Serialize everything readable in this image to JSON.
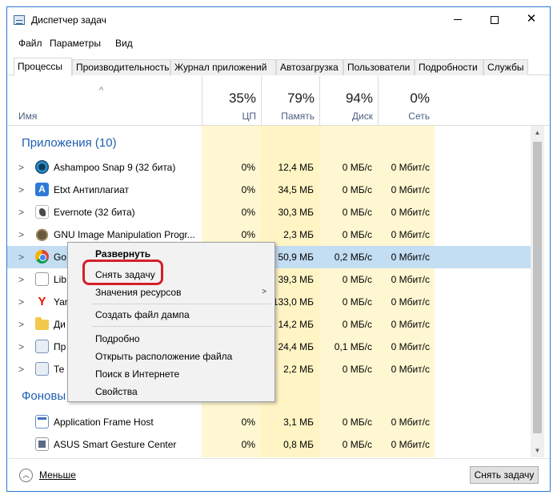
{
  "window": {
    "title": "Диспетчер задач"
  },
  "menu": [
    "Файл",
    "Параметры",
    "Вид"
  ],
  "tabs": [
    "Процессы",
    "Производительность",
    "Журнал приложений",
    "Автозагрузка",
    "Пользователи",
    "Подробности",
    "Службы"
  ],
  "columns": {
    "name": "Имя",
    "cpu": {
      "pct": "35%",
      "label": "ЦП"
    },
    "mem": {
      "pct": "79%",
      "label": "Память"
    },
    "disk": {
      "pct": "94%",
      "label": "Диск"
    },
    "net": {
      "pct": "0%",
      "label": "Сеть"
    }
  },
  "groups": {
    "apps": "Приложения (10)",
    "background": "Фоновы"
  },
  "rows": [
    {
      "name": "Ashampoo Snap 9 (32 бита)",
      "icon": "ashampoo-icon",
      "cpu": "0%",
      "mem": "12,4 МБ",
      "disk": "0 МБ/с",
      "net": "0 Мбит/с"
    },
    {
      "name": "Etxt Антиплагиат",
      "icon": "etxt-icon",
      "cpu": "0%",
      "mem": "34,5 МБ",
      "disk": "0 МБ/с",
      "net": "0 Мбит/с"
    },
    {
      "name": "Evernote (32 бита)",
      "icon": "evernote-icon",
      "cpu": "0%",
      "mem": "30,3 МБ",
      "disk": "0 МБ/с",
      "net": "0 Мбит/с"
    },
    {
      "name": "GNU Image Manipulation Progr...",
      "icon": "gimp-icon",
      "cpu": "0%",
      "mem": "2,3 МБ",
      "disk": "0 МБ/с",
      "net": "0 Мбит/с"
    },
    {
      "name": "Go",
      "icon": "chrome-icon",
      "cpu": "",
      "mem": "50,9 МБ",
      "disk": "0,2 МБ/с",
      "net": "0 Мбит/с"
    },
    {
      "name": "Lib",
      "icon": "libreoffice-icon",
      "cpu": "",
      "mem": "39,3 МБ",
      "disk": "0 МБ/с",
      "net": "0 Мбит/с"
    },
    {
      "name": "Yar",
      "icon": "yandex-icon",
      "cpu": "",
      "mem": "133,0 МБ",
      "disk": "0 МБ/с",
      "net": "0 Мбит/с"
    },
    {
      "name": "Ди",
      "icon": "folder-icon",
      "cpu": "",
      "mem": "14,2 МБ",
      "disk": "0 МБ/с",
      "net": "0 Мбит/с"
    },
    {
      "name": "Пр",
      "icon": "program-icon",
      "cpu": "",
      "mem": "24,4 МБ",
      "disk": "0,1 МБ/с",
      "net": "0 Мбит/с"
    },
    {
      "name": "Те",
      "icon": "text-editor-icon",
      "cpu": "",
      "mem": "2,2 МБ",
      "disk": "0 МБ/с",
      "net": "0 Мбит/с"
    }
  ],
  "bg_rows": [
    {
      "name": "Application Frame Host",
      "icon": "frame-host-icon",
      "cpu": "0%",
      "mem": "3,1 МБ",
      "disk": "0 МБ/с",
      "net": "0 Мбит/с"
    },
    {
      "name": "ASUS Smart Gesture Center",
      "icon": "asus-icon",
      "cpu": "0%",
      "mem": "0,8 МБ",
      "disk": "0 МБ/с",
      "net": "0 Мбит/с"
    }
  ],
  "context_menu": {
    "expand": "Развернуть",
    "end_task": "Снять задачу",
    "resource_values": "Значения ресурсов",
    "create_dump": "Создать файл дампа",
    "details": "Подробно",
    "open_location": "Открыть расположение файла",
    "search_online": "Поиск в Интернете",
    "properties": "Свойства"
  },
  "footer": {
    "less_label": "Меньше",
    "end_task_button": "Снять задачу"
  },
  "colors": {
    "accent_border": "#2b79d6",
    "highlight_red": "#d3202a",
    "group_title": "#1e5fb0",
    "column_yellow": "#fff7d1",
    "selection": "#d4e7f7"
  }
}
